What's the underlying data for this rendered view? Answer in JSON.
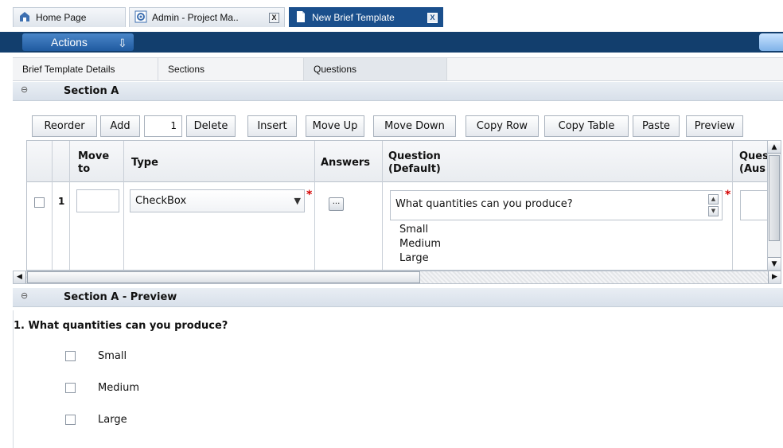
{
  "tabs": [
    {
      "label": "Home Page",
      "icon": "home-icon",
      "active": false
    },
    {
      "label": "Admin - Project Ma..",
      "icon": "gear-icon",
      "active": false,
      "close": "X"
    },
    {
      "label": "New Brief Template",
      "icon": "document-icon",
      "active": true,
      "close": "X"
    }
  ],
  "actions": {
    "label": "Actions",
    "icon": "arrow-down-icon"
  },
  "subtabs": [
    "Brief Template Details",
    "Sections",
    "Questions"
  ],
  "section": {
    "title": "Section A",
    "collapse": "⊖"
  },
  "toolbar": {
    "reorder": "Reorder",
    "add": "Add",
    "add_count": "1",
    "delete": "Delete",
    "insert": "Insert",
    "move_up": "Move Up",
    "move_down": "Move Down",
    "copy_row": "Copy Row",
    "copy_table": "Copy Table",
    "paste": "Paste",
    "preview": "Preview"
  },
  "grid": {
    "headers": {
      "move_to": [
        "Move",
        "to"
      ],
      "type": "Type",
      "answers": "Answers",
      "question_default": [
        "Question",
        "(Default)"
      ],
      "question_aus": [
        "Ques",
        "(Aus"
      ]
    },
    "row": {
      "number": "1",
      "move_to": "",
      "type": "CheckBox",
      "answers_button": "...",
      "question": "What quantities can you produce?",
      "answers": [
        "Small",
        "Medium",
        "Large"
      ],
      "required_mark": "*"
    }
  },
  "preview": {
    "title": "Section A - Preview",
    "collapse": "⊖",
    "question": "1. What quantities can you produce?",
    "options": [
      "Small",
      "Medium",
      "Large"
    ]
  },
  "colors": {
    "accent": "#1a4f8c",
    "actions_bar": "#123e6d",
    "required": "#d40000"
  }
}
